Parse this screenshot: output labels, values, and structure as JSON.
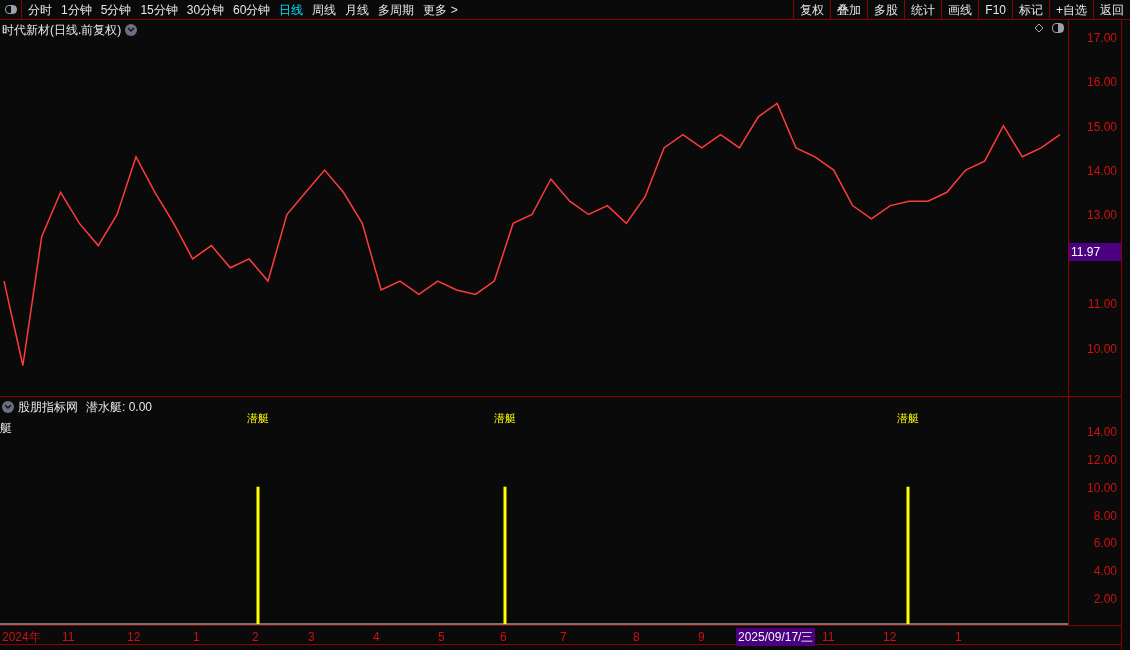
{
  "toolbar": {
    "periods": [
      {
        "label": "分时",
        "selected": false
      },
      {
        "label": "1分钟",
        "selected": false
      },
      {
        "label": "5分钟",
        "selected": false
      },
      {
        "label": "15分钟",
        "selected": false
      },
      {
        "label": "30分钟",
        "selected": false
      },
      {
        "label": "60分钟",
        "selected": false
      },
      {
        "label": "日线",
        "selected": true
      },
      {
        "label": "周线",
        "selected": false
      },
      {
        "label": "月线",
        "selected": false
      },
      {
        "label": "多周期",
        "selected": false
      },
      {
        "label": "更多 >",
        "selected": false
      }
    ],
    "buttons": [
      "复权",
      "叠加",
      "多股",
      "统计",
      "画线",
      "F10",
      "标记",
      "+自选",
      "返回"
    ]
  },
  "main_chart": {
    "title": "时代新材(日线.前复权)",
    "current_price": "11.97",
    "chart_data": {
      "type": "line",
      "ylim": [
        8.89,
        17.38
      ],
      "categories": [
        null,
        null,
        null,
        null,
        null,
        null,
        null,
        null,
        null,
        null,
        null,
        null,
        null,
        null,
        null,
        null,
        null,
        null,
        null,
        null,
        null,
        null,
        null,
        null,
        null,
        null,
        null,
        null,
        null,
        null,
        null,
        null,
        null,
        null,
        null,
        null,
        null,
        null,
        null,
        null,
        null,
        null,
        null,
        null,
        null,
        null,
        null,
        null,
        null,
        null,
        null,
        null,
        null,
        null,
        null,
        null,
        null
      ],
      "yticks": [
        {
          "value": 17,
          "label": "17.00"
        },
        {
          "value": 16,
          "label": "16.00"
        },
        {
          "value": 15,
          "label": "15.00"
        },
        {
          "value": 14,
          "label": "14.00"
        },
        {
          "value": 13,
          "label": "13.00"
        },
        {
          "value": 11,
          "label": "11.00"
        },
        {
          "value": 10,
          "label": "10.00"
        }
      ],
      "series": [
        {
          "color": "#ff3b3b",
          "values": [
            11.5,
            9.6,
            12.5,
            13.5,
            12.8,
            12.3,
            13.0,
            14.3,
            13.5,
            12.8,
            12.0,
            12.3,
            11.8,
            12.0,
            11.5,
            13.0,
            13.5,
            14.0,
            13.5,
            12.8,
            11.3,
            11.5,
            11.2,
            11.5,
            11.3,
            11.2,
            11.5,
            12.8,
            13.0,
            13.8,
            13.3,
            13.0,
            13.2,
            12.8,
            13.4,
            14.5,
            14.8,
            14.5,
            14.8,
            14.5,
            15.2,
            15.5,
            14.5,
            14.3,
            14.0,
            13.2,
            12.9,
            13.2,
            13.3,
            13.3,
            13.5,
            14.0,
            14.2,
            15.0,
            14.3,
            14.5,
            14.8
          ]
        }
      ]
    }
  },
  "indicator": {
    "title": "股朋指标网",
    "name": "潜水艇: 0.00",
    "left_label": "艇",
    "signal_labels": [
      "潜艇",
      "潜艇",
      "潜艇"
    ],
    "chart_data": {
      "type": "bar",
      "categories": [
        null,
        null,
        null
      ],
      "ylim": [
        0,
        16.44
      ],
      "yticks": [
        {
          "value": 14,
          "label": "14.00"
        },
        {
          "value": 12,
          "label": "12.00"
        },
        {
          "value": 10,
          "label": "10.00"
        },
        {
          "value": 8,
          "label": "8.00"
        },
        {
          "value": 6,
          "label": "6.00"
        },
        {
          "value": 4,
          "label": "4.00"
        },
        {
          "value": 2,
          "label": "2.00"
        }
      ],
      "series": [
        {
          "color": "#ffff00",
          "values": [
            10,
            10,
            10
          ]
        }
      ]
    }
  },
  "date_axis": [
    {
      "label": "2024年",
      "selected": false
    },
    {
      "label": "11",
      "selected": false
    },
    {
      "label": "12",
      "selected": false
    },
    {
      "label": "1",
      "selected": false
    },
    {
      "label": "2",
      "selected": false
    },
    {
      "label": "3",
      "selected": false
    },
    {
      "label": "4",
      "selected": false
    },
    {
      "label": "5",
      "selected": false
    },
    {
      "label": "6",
      "selected": false
    },
    {
      "label": "7",
      "selected": false
    },
    {
      "label": "8",
      "selected": false
    },
    {
      "label": "9",
      "selected": false
    },
    {
      "label": "2025/09/17/三",
      "selected": true
    },
    {
      "label": "11",
      "selected": false
    },
    {
      "label": "12",
      "selected": false
    },
    {
      "label": "1",
      "selected": false
    }
  ]
}
